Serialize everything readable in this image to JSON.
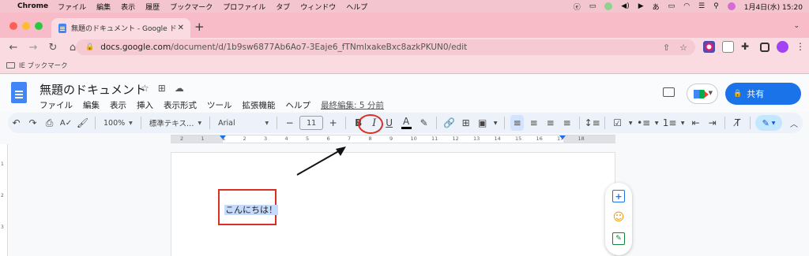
{
  "menubar": {
    "app": "Chrome",
    "items": [
      "ファイル",
      "編集",
      "表示",
      "履歴",
      "ブックマーク",
      "プロファイル",
      "タブ",
      "ウィンドウ",
      "ヘルプ"
    ],
    "input_method": "あ",
    "datetime": "1月4日(水)  15:20"
  },
  "browser": {
    "tab_title": "無題のドキュメント - Google ド",
    "url_host": "docs.google.com",
    "url_path": "/document/d/1b9sw6877Ab6Ao7-3Eaje6_fTNmlxakeBxc8azkPKUN0/edit",
    "bookmark": "IE ブックマーク"
  },
  "docs": {
    "title": "無題のドキュメント",
    "menu": [
      "ファイル",
      "編集",
      "表示",
      "挿入",
      "表示形式",
      "ツール",
      "拡張機能",
      "ヘルプ"
    ],
    "last_edit": "最終編集: 5 分前",
    "share_label": "共有"
  },
  "toolbar": {
    "zoom": "100%",
    "style": "標準テキス…",
    "font": "Arial",
    "font_size": "11",
    "bold": "B",
    "italic": "I",
    "underline": "U",
    "text_color": "A",
    "input_mode": "あ"
  },
  "ruler": {
    "labels": [
      "2",
      "1",
      "1",
      "2",
      "3",
      "4",
      "5",
      "6",
      "7",
      "8",
      "9",
      "10",
      "11",
      "12",
      "13",
      "14",
      "15",
      "16",
      "17",
      "18"
    ]
  },
  "vruler": {
    "labels": [
      "1",
      "2",
      "3"
    ]
  },
  "document": {
    "text": "こんにちは！"
  },
  "colors": {
    "accent": "#1a73e8",
    "annotation": "#d93025",
    "chrome_pink": "#f7bcc7"
  }
}
